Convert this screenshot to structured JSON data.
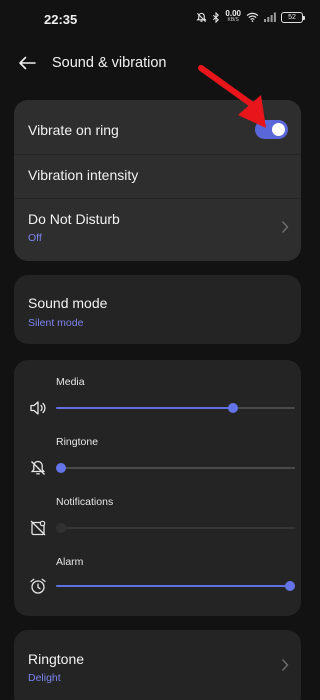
{
  "status": {
    "time": "22:35",
    "net_speed_value": "0.00",
    "net_speed_unit": "KB/S",
    "battery": "52"
  },
  "header": {
    "title": "Sound & vibration"
  },
  "settings_card": {
    "vibrate_on_ring": {
      "label": "Vibrate on ring",
      "enabled": true
    },
    "vibration_intensity": {
      "label": "Vibration intensity"
    },
    "do_not_disturb": {
      "label": "Do Not Disturb",
      "value": "Off"
    }
  },
  "sound_mode": {
    "label": "Sound mode",
    "value": "Silent mode"
  },
  "volumes": [
    {
      "label": "Media",
      "icon": "speaker-icon",
      "level": 0.75,
      "disabled": false
    },
    {
      "label": "Ringtone",
      "icon": "bell-off-icon",
      "level": 0.0,
      "disabled": false
    },
    {
      "label": "Notifications",
      "icon": "notification-off-icon",
      "level": 0.0,
      "disabled": true
    },
    {
      "label": "Alarm",
      "icon": "alarm-clock-icon",
      "level": 1.0,
      "disabled": false
    }
  ],
  "ringtone": {
    "label": "Ringtone",
    "value": "Delight"
  },
  "colors": {
    "accent": "#5a67d8",
    "annotation_arrow": "#e8161b",
    "background": "#121212",
    "card": "#242424"
  }
}
